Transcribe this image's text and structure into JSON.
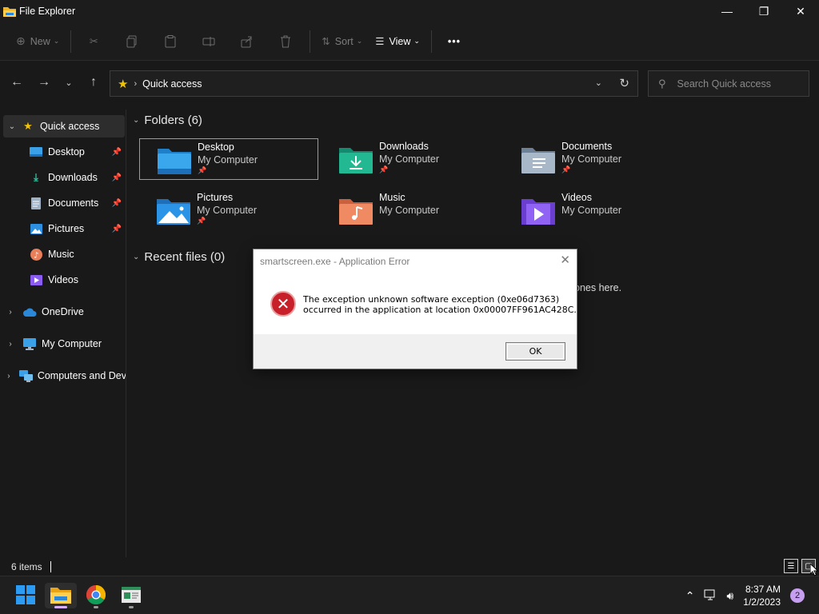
{
  "window": {
    "title": "File Explorer",
    "controls": {
      "minimize": "—",
      "maximize": "❐",
      "close": "✕"
    }
  },
  "toolbar": {
    "new_label": "New",
    "sort_label": "Sort",
    "view_label": "View",
    "more_label": "•••"
  },
  "address": {
    "location": "Quick access",
    "search_placeholder": "Search Quick access"
  },
  "sidebar": {
    "items": [
      {
        "label": "Quick access",
        "icon": "star-icon"
      },
      {
        "label": "Desktop",
        "icon": "desktop-icon",
        "pinned": true
      },
      {
        "label": "Downloads",
        "icon": "download-icon",
        "pinned": true
      },
      {
        "label": "Documents",
        "icon": "document-icon",
        "pinned": true
      },
      {
        "label": "Pictures",
        "icon": "picture-icon",
        "pinned": true
      },
      {
        "label": "Music",
        "icon": "music-icon"
      },
      {
        "label": "Videos",
        "icon": "video-icon"
      },
      {
        "label": "OneDrive",
        "icon": "cloud-icon"
      },
      {
        "label": "My Computer",
        "icon": "monitor-icon"
      },
      {
        "label": "Computers and Dev",
        "icon": "network-icon"
      }
    ]
  },
  "main": {
    "folders_header": "Folders (6)",
    "recent_header": "Recent files (0)",
    "recent_hint": "ones here.",
    "folders": [
      {
        "name": "Desktop",
        "location": "My Computer",
        "color": "#3aa0e8"
      },
      {
        "name": "Downloads",
        "location": "My Computer",
        "color": "#1fae8c"
      },
      {
        "name": "Documents",
        "location": "My Computer",
        "color": "#8fa3b8"
      },
      {
        "name": "Pictures",
        "location": "My Computer",
        "color": "#2c8fe0"
      },
      {
        "name": "Music",
        "location": "My Computer",
        "color": "#e87e5a"
      },
      {
        "name": "Videos",
        "location": "My Computer",
        "color": "#8b5cf0"
      }
    ]
  },
  "status": {
    "count": "6 items"
  },
  "dialog": {
    "title": "smartscreen.exe - Application Error",
    "message_line1": "The exception unknown software exception (0xe06d7363)",
    "message_line2": "occurred in the application at location 0x00007FF961AC428C.",
    "ok_label": "OK"
  },
  "taskbar": {
    "time": "8:37 AM",
    "date": "1/2/2023",
    "notifications": "2"
  }
}
